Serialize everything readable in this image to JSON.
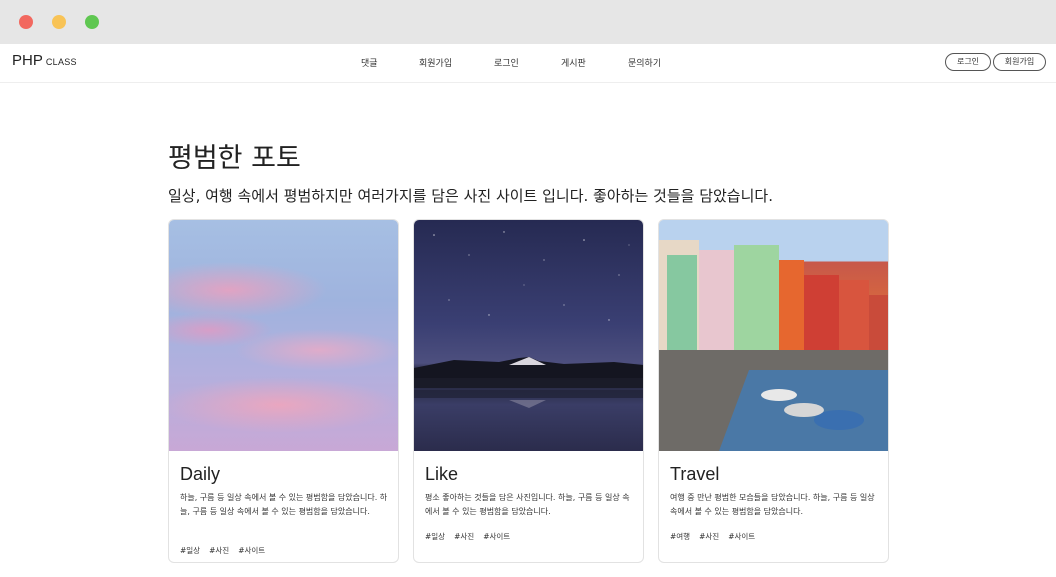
{
  "nav": {
    "logo": "PHP",
    "logo_sub": "CLASS",
    "menu": [
      "댓글",
      "회원가입",
      "로그인",
      "게시판",
      "문의하기"
    ],
    "login_button": "로그인",
    "signup_button": "회원가입"
  },
  "hero": {
    "title": "평범한 포토",
    "subtitle": "일상, 여행 속에서 평범하지만 여러가지를 담은 사진 사이트 입니다. 좋아하는 것들을 담았습니다."
  },
  "cards": [
    {
      "title": "Daily",
      "text": "하늘, 구름 등 일상 속에서 볼 수 있는 평범함을 담았습니다. 하늘, 구름 등 일상 속에서 볼 수 있는 평범함을 담았습니다.",
      "tags": [
        "#일상",
        "#사진",
        "#사이트"
      ]
    },
    {
      "title": "Like",
      "text": "평소 좋아하는 것들을 담은 사진입니다. 하늘, 구름 등 일상 속에서 볼 수 있는 평범함을 담았습니다.",
      "tags": [
        "#일상",
        "#사진",
        "#사이트"
      ]
    },
    {
      "title": "Travel",
      "text": "여행 중 만난 평범한 모습들을 담았습니다. 하늘, 구름 등 일상 속에서 볼 수 있는 평범함을 담았습니다.",
      "tags": [
        "#여행",
        "#사진",
        "#사이트"
      ]
    }
  ]
}
